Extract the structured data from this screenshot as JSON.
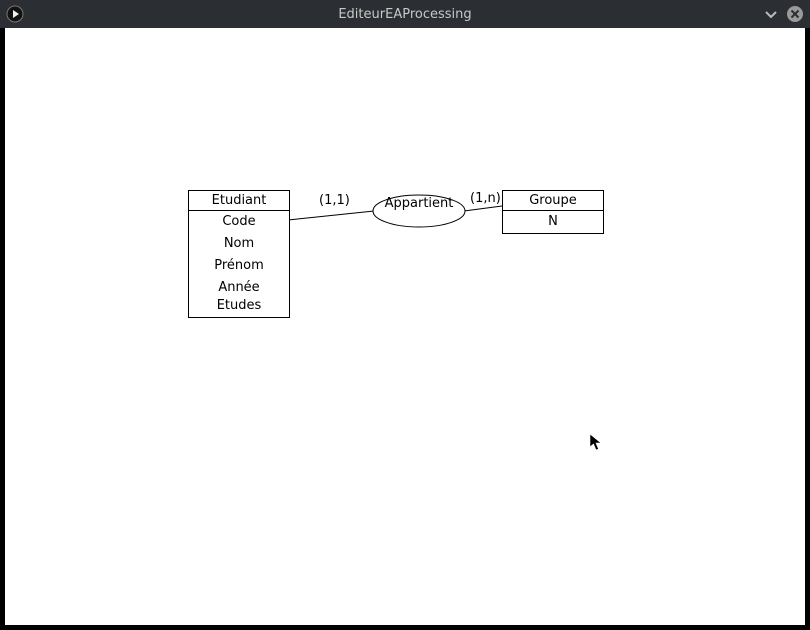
{
  "window": {
    "title": "EditeurEAProcessing"
  },
  "entities": {
    "etudiant": {
      "name": "Etudiant",
      "attrs": [
        "Code",
        "Nom",
        "Prénom",
        "Année Etudes"
      ]
    },
    "groupe": {
      "name": "Groupe",
      "attrs": [
        "N"
      ]
    }
  },
  "relation": {
    "name": "Appartient"
  },
  "cardinalities": {
    "left": "(1,1)",
    "right": "(1,n)"
  }
}
